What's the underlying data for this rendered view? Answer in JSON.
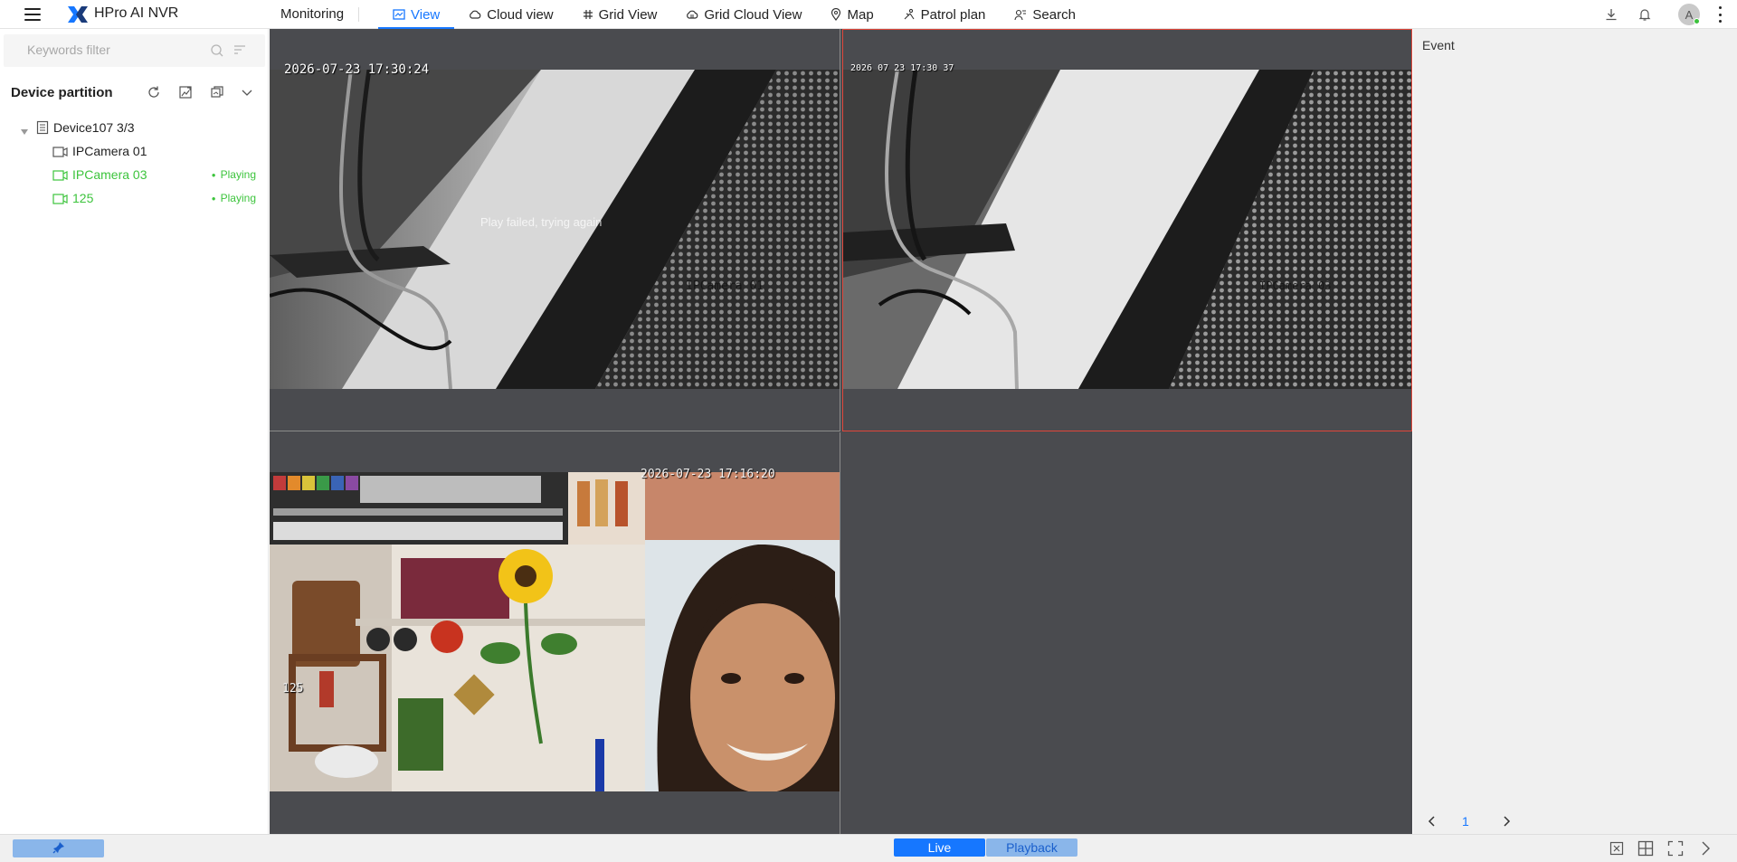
{
  "app": {
    "title": "HPro AI NVR",
    "section": "Monitoring",
    "accent_color": "#1677ff"
  },
  "tabs": [
    {
      "label": "View",
      "icon": "view-icon",
      "active": true
    },
    {
      "label": "Cloud view",
      "icon": "cloud-icon",
      "active": false
    },
    {
      "label": "Grid View",
      "icon": "grid-hash-icon",
      "active": false
    },
    {
      "label": "Grid Cloud View",
      "icon": "grid-cloud-icon",
      "active": false
    },
    {
      "label": "Map",
      "icon": "map-pin-icon",
      "active": false
    },
    {
      "label": "Patrol plan",
      "icon": "patrol-icon",
      "active": false
    },
    {
      "label": "Search",
      "icon": "search-person-icon",
      "active": false
    }
  ],
  "user": {
    "avatar_initial": "A"
  },
  "sidebar": {
    "search_placeholder": "Keywords filter",
    "partition_title": "Device partition",
    "tree": {
      "device": {
        "label": "Device107 3/3"
      },
      "cameras": [
        {
          "label": "IPCamera 01",
          "status": "",
          "playing": false
        },
        {
          "label": "IPCamera 03",
          "status": "Playing",
          "playing": true
        },
        {
          "label": "125",
          "status": "Playing",
          "playing": true
        }
      ]
    }
  },
  "video": {
    "cells": [
      {
        "timestamp": "2026-07-23 17:30:24",
        "message": "Play failed, trying again",
        "caption": "IPCamera 01"
      },
      {
        "timestamp": "2026 07 23 17:30 37",
        "message": "",
        "caption": "IPCamera 03",
        "selected": true
      },
      {
        "timestamp": "2026-07-23 17:16:20",
        "message": "",
        "caption": "125"
      },
      {
        "timestamp": "",
        "message": "",
        "caption": ""
      }
    ],
    "selected_border_color": "#e0463a"
  },
  "event_panel": {
    "title": "Event",
    "page": "1"
  },
  "bottom": {
    "live_label": "Live",
    "playback_label": "Playback",
    "status_color": "#3dc43d"
  }
}
